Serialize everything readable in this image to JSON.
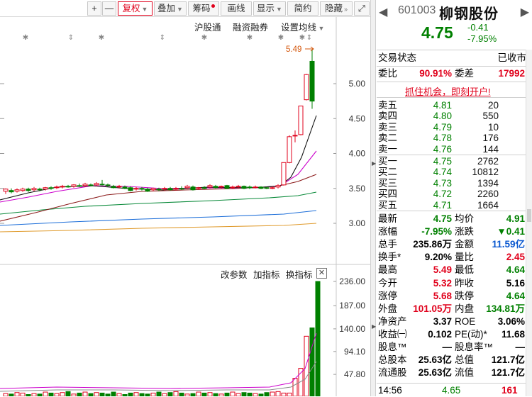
{
  "toolbar": {
    "plus": "+",
    "minus": "—",
    "fuquan": "复权",
    "diejia": "叠加",
    "chouma": "筹码",
    "huaxian": "画线",
    "xianshi": "显示",
    "jianyue": "简约",
    "yincang": "隐藏",
    "fullscreen": "⤢"
  },
  "chart_links": {
    "hgt": "沪股通",
    "rzrq": "融资融券",
    "settings": "设置均线"
  },
  "price_axis": [
    "5.00",
    "4.50",
    "4.00",
    "3.50",
    "3.00"
  ],
  "high_marker": "5.49",
  "volume_header": {
    "params": "改参数",
    "add": "加指标",
    "swap": "换指标",
    "close": "✕"
  },
  "volume_axis": [
    "236.00",
    "187.00",
    "140.00",
    "94.10",
    "47.80"
  ],
  "stock": {
    "code": "601003",
    "name": "柳钢股份",
    "price": "4.75",
    "change": "-0.41",
    "change_pct": "-7.95%"
  },
  "status": {
    "label": "交易状态",
    "value": "已收市"
  },
  "weibi": {
    "label": "委比",
    "value": "90.91%",
    "label2": "委差",
    "value2": "17992"
  },
  "promo": "抓住机会，即刻开户!",
  "asks": [
    {
      "label": "卖五",
      "price": "4.81",
      "vol": "20"
    },
    {
      "label": "卖四",
      "price": "4.80",
      "vol": "550"
    },
    {
      "label": "卖三",
      "price": "4.79",
      "vol": "10"
    },
    {
      "label": "卖二",
      "price": "4.78",
      "vol": "176"
    },
    {
      "label": "卖一",
      "price": "4.76",
      "vol": "144"
    }
  ],
  "bids": [
    {
      "label": "买一",
      "price": "4.75",
      "vol": "2762"
    },
    {
      "label": "买二",
      "price": "4.74",
      "vol": "10812"
    },
    {
      "label": "买三",
      "price": "4.73",
      "vol": "1394"
    },
    {
      "label": "买四",
      "price": "4.72",
      "vol": "2260"
    },
    {
      "label": "买五",
      "price": "4.71",
      "vol": "1664"
    }
  ],
  "quote": [
    {
      "l1": "最新",
      "v1": "4.75",
      "c1": "green",
      "l2": "均价",
      "v2": "4.91",
      "c2": "green"
    },
    {
      "l1": "涨幅",
      "v1": "-7.95%",
      "c1": "green",
      "l2": "涨跌",
      "v2": "▼0.41",
      "c2": "green"
    },
    {
      "l1": "总手",
      "v1": "235.86万",
      "c1": "black",
      "l2": "金额",
      "v2": "11.59亿",
      "c2": "blue"
    },
    {
      "l1": "换手*",
      "v1": "9.20%",
      "c1": "black",
      "l2": "量比",
      "v2": "2.45",
      "c2": "red"
    },
    {
      "l1": "最高",
      "v1": "5.49",
      "c1": "red",
      "l2": "最低",
      "v2": "4.64",
      "c2": "green"
    },
    {
      "l1": "今开",
      "v1": "5.32",
      "c1": "red",
      "l2": "昨收",
      "v2": "5.16",
      "c2": "black"
    },
    {
      "l1": "涨停",
      "v1": "5.68",
      "c1": "red",
      "l2": "跌停",
      "v2": "4.64",
      "c2": "green"
    },
    {
      "l1": "外盘",
      "v1": "101.05万",
      "c1": "red",
      "l2": "内盘",
      "v2": "134.81万",
      "c2": "green"
    },
    {
      "l1": "净资产",
      "v1": "3.37",
      "c1": "black",
      "l2": "ROE",
      "v2": "3.06%",
      "c2": "black"
    },
    {
      "l1": "收益㈠",
      "v1": "0.102",
      "c1": "black",
      "l2": "PE(动)*",
      "v2": "11.68",
      "c2": "black"
    },
    {
      "l1": "股息™",
      "v1": "—",
      "c1": "black",
      "l2": "股息率™",
      "v2": "—",
      "c2": "black"
    },
    {
      "l1": "总股本",
      "v1": "25.63亿",
      "c1": "black",
      "l2": "总值",
      "v2": "121.7亿",
      "c2": "black"
    },
    {
      "l1": "流通股",
      "v1": "25.63亿",
      "c1": "black",
      "l2": "流值",
      "v2": "121.7亿",
      "c2": "black"
    }
  ],
  "last_tick": {
    "time": "14:56",
    "price": "4.65",
    "vol": "161"
  },
  "colors": {
    "up": "#e0001b",
    "down": "#008000",
    "ma5": "#111111",
    "ma10": "#cc00cc",
    "ma20": "#8b1a1a",
    "ma30": "#0a8a3a",
    "ma60": "#1e6fd9",
    "ma120": "#e09b2d"
  }
}
